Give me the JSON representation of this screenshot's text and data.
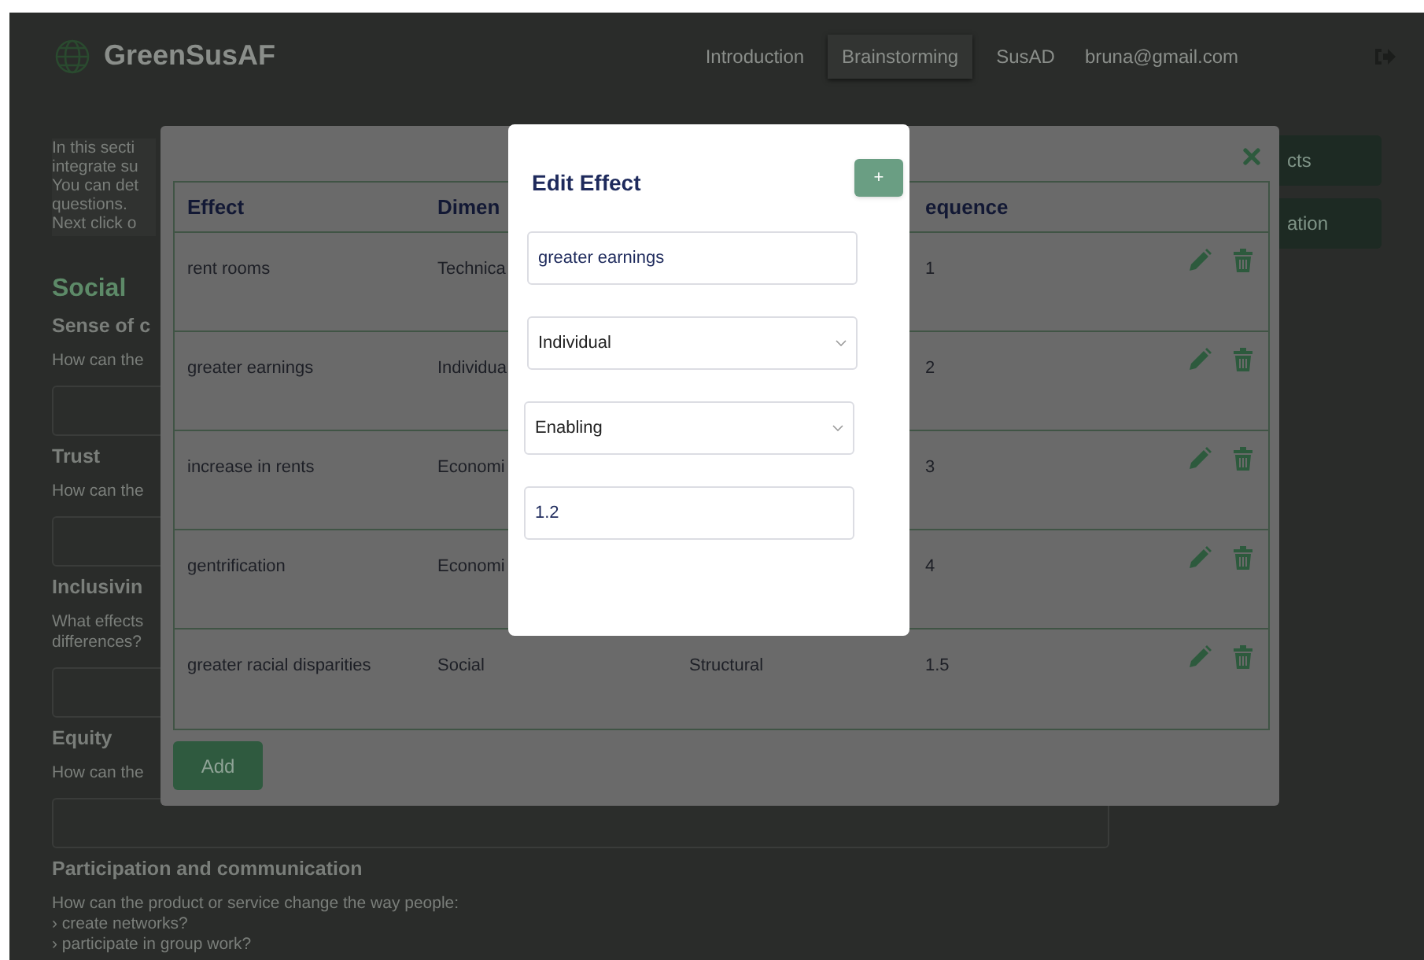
{
  "header": {
    "logo": "GreenSusAF",
    "nav": [
      {
        "label": "Introduction",
        "selected": false
      },
      {
        "label": "Brainstorming",
        "selected": true
      },
      {
        "label": "SusAD",
        "selected": false
      }
    ],
    "user_email": "bruna@gmail.com"
  },
  "page": {
    "intro_lines": [
      "In this secti",
      "integrate su",
      "You can det",
      "questions.",
      "Next click o"
    ],
    "category": "Social",
    "questions": [
      {
        "title": "Sense of c",
        "prompt_lines": [
          "How can the"
        ],
        "field": true
      },
      {
        "title": "Trust",
        "prompt_lines": [
          "How can the"
        ],
        "field": true
      },
      {
        "title": "Inclusivin",
        "prompt_lines": [
          "What effects",
          "differences?"
        ],
        "field": true
      },
      {
        "title": "Equity",
        "prompt_lines": [
          "How can the"
        ],
        "field": true
      },
      {
        "title": "Participation and communication",
        "prompt_lines": [
          "How can the product or service change the way people:",
          "› create networks?",
          "› participate in group work?"
        ],
        "field": false
      }
    ],
    "side_buttons": [
      "cts",
      "ation"
    ]
  },
  "effects_dialog": {
    "columns": [
      "Effect",
      "Dimen",
      "equence"
    ],
    "rows": [
      {
        "effect": "rent rooms",
        "dimension": "Technica",
        "sequence": "1"
      },
      {
        "effect": "greater earnings",
        "dimension": "Individua",
        "sequence": "2"
      },
      {
        "effect": "increase in rents",
        "dimension": "Economi",
        "sequence": "3"
      },
      {
        "effect": "gentrification",
        "dimension": "Economi",
        "sequence": "4"
      },
      {
        "effect": "greater racial disparities",
        "dimension": "Social",
        "column_3": "Structural",
        "sequence": "1.5"
      }
    ],
    "add_button": "Add"
  },
  "edit_dialog": {
    "title": "Edit Effect",
    "add_button": "+",
    "fields": [
      {
        "kind": "input",
        "value": "greater earnings"
      },
      {
        "kind": "select",
        "value": "Individual"
      },
      {
        "kind": "select",
        "value": "Enabling"
      },
      {
        "kind": "input",
        "value": "1.2"
      }
    ]
  }
}
